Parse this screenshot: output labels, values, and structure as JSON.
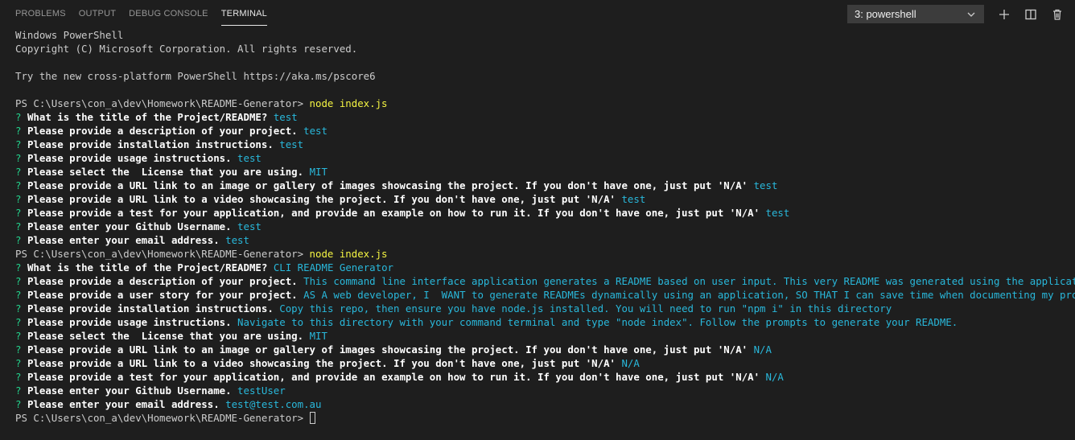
{
  "tabs": [
    {
      "label": "PROBLEMS",
      "active": false
    },
    {
      "label": "OUTPUT",
      "active": false
    },
    {
      "label": "DEBUG CONSOLE",
      "active": false
    },
    {
      "label": "TERMINAL",
      "active": true
    }
  ],
  "terminal_select": {
    "value": "3: powershell"
  },
  "icons": {
    "dropdown": "chevron-down-icon",
    "new": "plus-icon",
    "split": "split-terminal-icon",
    "delete": "trash-icon"
  },
  "colors": {
    "background": "#1e1e1e",
    "text": "#cccccc",
    "question_mark": "#23d18b",
    "answer": "#29b8db",
    "command": "#f5f543"
  },
  "header_lines": [
    "Windows PowerShell",
    "Copyright (C) Microsoft Corporation. All rights reserved.",
    "",
    "Try the new cross-platform PowerShell https://aka.ms/pscore6",
    ""
  ],
  "shell_prompt": "PS C:\\Users\\con_a\\dev\\Homework\\README-Generator> ",
  "command": "node index.js",
  "question_mark": "?",
  "runs": [
    {
      "qa": [
        {
          "q": "What is the title of the Project/README?",
          "a": "test"
        },
        {
          "q": "Please provide a description of your project.",
          "a": "test"
        },
        {
          "q": "Please provide installation instructions.",
          "a": "test"
        },
        {
          "q": "Please provide usage instructions.",
          "a": "test"
        },
        {
          "q": "Please select the  License that you are using.",
          "a": "MIT"
        },
        {
          "q": "Please provide a URL link to an image or gallery of images showcasing the project. If you don't have one, just put 'N/A'",
          "a": "test"
        },
        {
          "q": "Please provide a URL link to a video showcasing the project. If you don't have one, just put 'N/A'",
          "a": "test"
        },
        {
          "q": "Please provide a test for your application, and provide an example on how to run it. If you don't have one, just put 'N/A'",
          "a": "test"
        },
        {
          "q": "Please enter your Github Username.",
          "a": "test"
        },
        {
          "q": "Please enter your email address.",
          "a": "test"
        }
      ]
    },
    {
      "qa": [
        {
          "q": "What is the title of the Project/README?",
          "a": "CLI README Generator"
        },
        {
          "q": "Please provide a description of your project.",
          "a": "This command line interface application generates a README based on user input. This very README was generated using the application!"
        },
        {
          "q": "Please provide a user story for your project.",
          "a": "AS A web developer, I  WANT to generate READMEs dynamically using an application, SO THAT I can save time when documenting my projects."
        },
        {
          "q": "Please provide installation instructions.",
          "a": "Copy this repo, then ensure you have node.js installed. You will need to run \"npm i\" in this directory"
        },
        {
          "q": "Please provide usage instructions.",
          "a": "Navigate to this directory with your command terminal and type \"node index\". Follow the prompts to generate your README."
        },
        {
          "q": "Please select the  License that you are using.",
          "a": "MIT"
        },
        {
          "q": "Please provide a URL link to an image or gallery of images showcasing the project. If you don't have one, just put 'N/A'",
          "a": "N/A"
        },
        {
          "q": "Please provide a URL link to a video showcasing the project. If you don't have one, just put 'N/A'",
          "a": "N/A"
        },
        {
          "q": "Please provide a test for your application, and provide an example on how to run it. If you don't have one, just put 'N/A'",
          "a": "N/A"
        },
        {
          "q": "Please enter your Github Username.",
          "a": "testUser"
        },
        {
          "q": "Please enter your email address.",
          "a": "test@test.com.au"
        }
      ]
    }
  ]
}
